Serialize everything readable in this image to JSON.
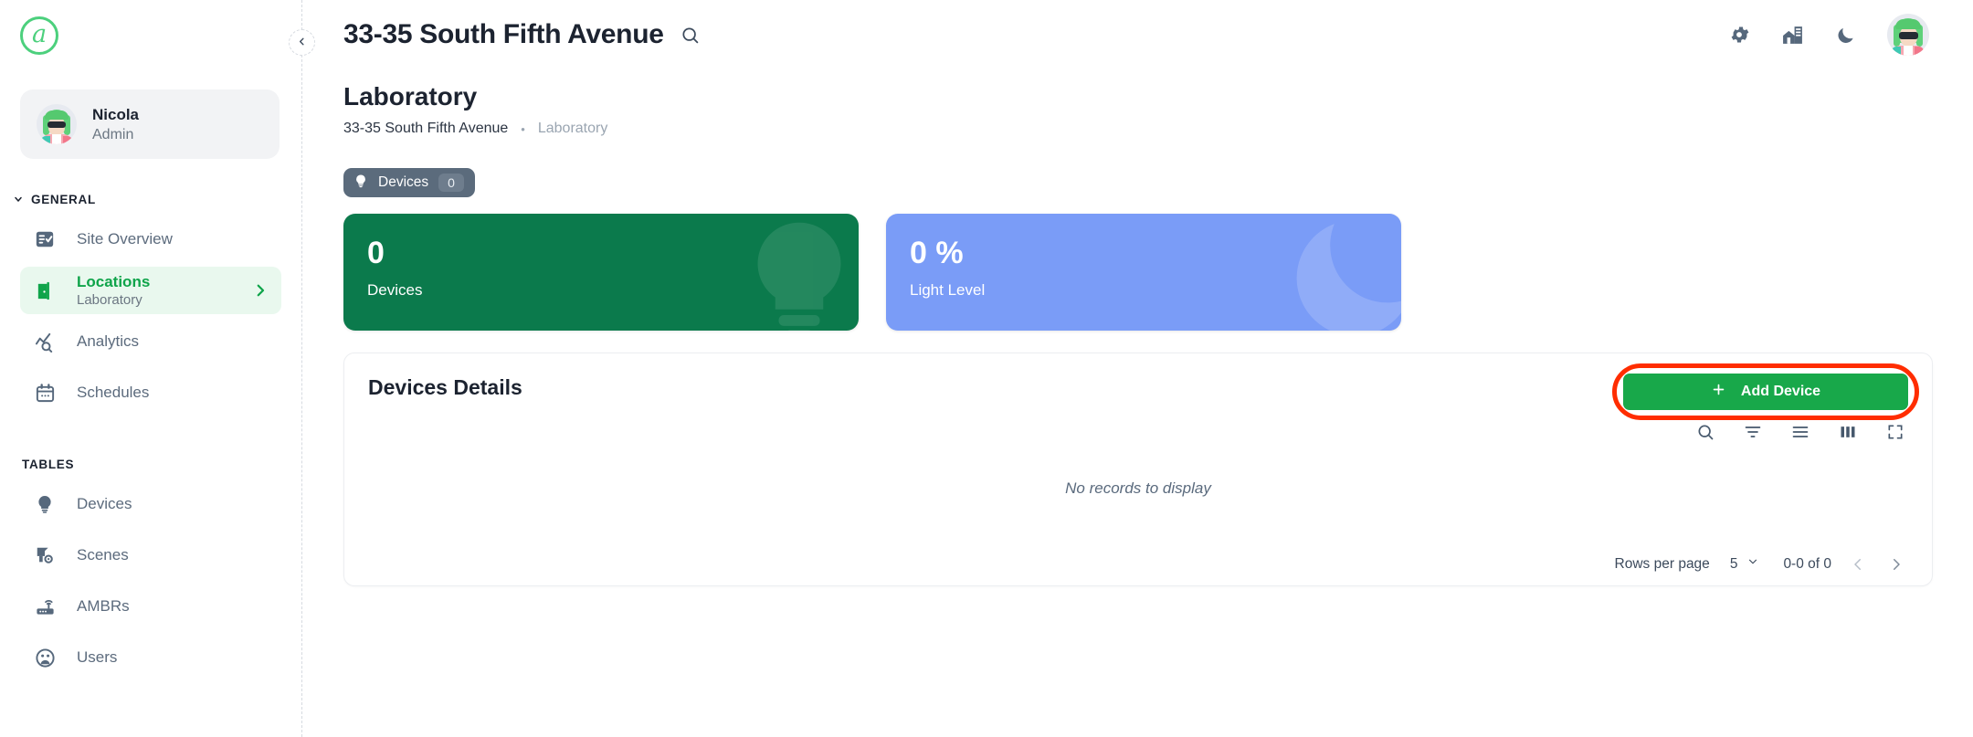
{
  "brand": {
    "logo_letter": "a",
    "logo_color": "#4cd07d"
  },
  "sidebar": {
    "user": {
      "name": "Nicola",
      "role": "Admin",
      "avatar": "user-avatar"
    },
    "collapse_icon": "chevron-left-icon",
    "groups": [
      {
        "label": "GENERAL",
        "collapse_icon": "chevron-down-icon",
        "items": [
          {
            "label": "Site Overview",
            "icon": "site-overview-icon",
            "sub": "",
            "active": false
          },
          {
            "label": "Locations",
            "icon": "door-icon",
            "sub": "Laboratory",
            "active": true,
            "arrow_icon": "chevron-right-icon"
          },
          {
            "label": "Analytics",
            "icon": "analytics-icon",
            "sub": "",
            "active": false
          },
          {
            "label": "Schedules",
            "icon": "calendar-icon",
            "sub": "",
            "active": false
          }
        ]
      },
      {
        "label": "TABLES",
        "items": [
          {
            "label": "Devices",
            "icon": "bulb-icon",
            "sub": "",
            "active": false
          },
          {
            "label": "Scenes",
            "icon": "scenes-icon",
            "sub": "",
            "active": false
          },
          {
            "label": "AMBRs",
            "icon": "router-icon",
            "sub": "",
            "active": false
          },
          {
            "label": "Users",
            "icon": "users-icon",
            "sub": "",
            "active": false
          }
        ]
      }
    ]
  },
  "topbar": {
    "title": "33-35 South Fifth Avenue",
    "search_icon": "search-icon",
    "actions": [
      {
        "icon": "gear-icon",
        "name": "settings-button"
      },
      {
        "icon": "building-icon",
        "name": "buildings-button"
      },
      {
        "icon": "moon-icon",
        "name": "dark-mode-button"
      }
    ],
    "avatar": "user-avatar"
  },
  "page": {
    "title": "Laboratory",
    "breadcrumb": [
      {
        "label": "33-35 South Fifth Avenue",
        "current": false
      },
      {
        "label": "Laboratory",
        "current": true
      }
    ],
    "breadcrumb_separator": "•"
  },
  "tabs": [
    {
      "label": "Devices",
      "count": "0",
      "icon": "bulb-icon",
      "active": true
    }
  ],
  "stat_cards": [
    {
      "value": "0",
      "label": "Devices",
      "color": "#0b7a4c",
      "watermark": "bulb-icon"
    },
    {
      "value": "0 %",
      "label": "Light Level",
      "color": "#7a9cf7",
      "watermark": "moon-icon"
    }
  ],
  "panel": {
    "title": "Devices Details",
    "add_button": {
      "label": "Add Device",
      "icon": "plus-icon",
      "color": "#18a84a",
      "highlighted": true
    },
    "tools": [
      {
        "icon": "search-icon",
        "name": "table-search-button"
      },
      {
        "icon": "filter-icon",
        "name": "table-filter-button"
      },
      {
        "icon": "density-icon",
        "name": "table-density-button"
      },
      {
        "icon": "columns-icon",
        "name": "table-columns-button"
      },
      {
        "icon": "fullscreen-icon",
        "name": "table-fullscreen-button"
      }
    ],
    "empty_message": "No records to display",
    "pagination": {
      "rows_per_page_label": "Rows per page",
      "rows_per_page_value": "5",
      "dropdown_icon": "chevron-down-icon",
      "range": "0-0 of 0",
      "prev_icon": "chevron-left-icon",
      "next_icon": "chevron-right-icon"
    }
  }
}
